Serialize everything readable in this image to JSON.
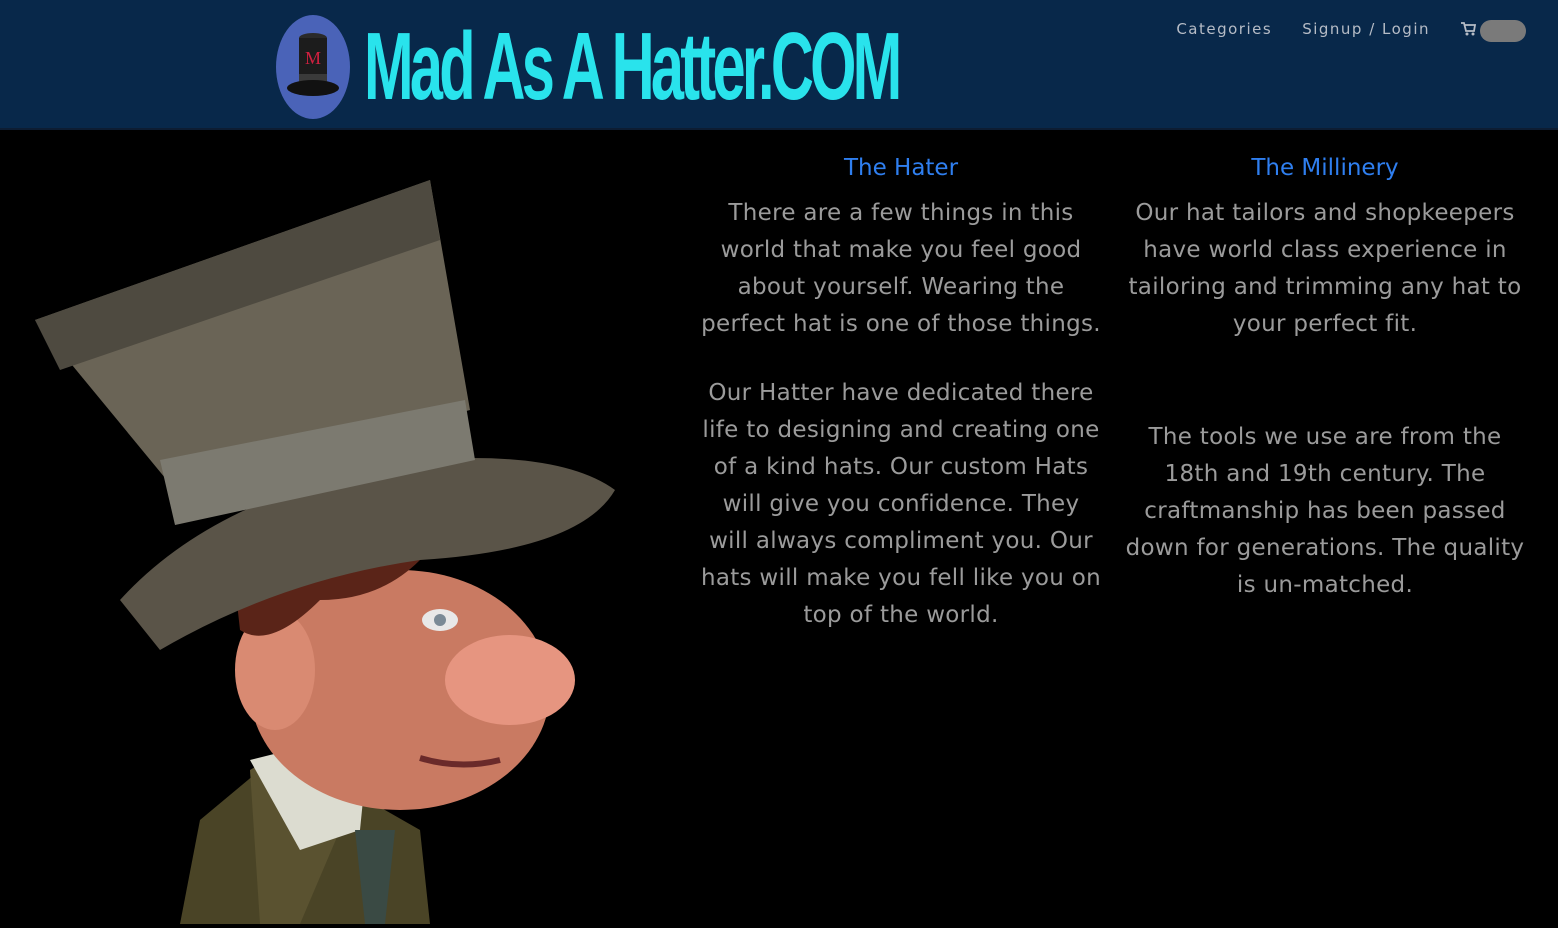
{
  "header": {
    "logo_text": "Mad As A Hatter.COM",
    "nav": {
      "categories": "Categories",
      "signup_login": "Signup / Login"
    },
    "cart_icon": "cart-icon"
  },
  "hero": {
    "image": "mad-hatter-illustration"
  },
  "sections": {
    "hater": {
      "title": "The Hater",
      "paragraph1": "There are a few things in this world that make you feel good about yourself. Wearing the perfect hat is one of those things.",
      "paragraph2": "Our Hatter have dedicated there life to designing and creating one of a kind hats. Our custom Hats will give you confidence. They will always compliment you. Our hats will make you fell like you on top of the world."
    },
    "millinery": {
      "title": "The Millinery",
      "paragraph1": "Our hat tailors and shopkeepers have world class experience in tailoring and trimming any hat to your perfect fit.",
      "paragraph2": "The tools we use are from the 18th and 19th century. The craftmanship has been passed down for generations. The quality is un-matched."
    }
  },
  "colors": {
    "navbar": "#08284a",
    "logo_text": "#29e3ec",
    "heading": "#2f7ff0",
    "body_text": "#9b9b9b",
    "background": "#000000"
  }
}
